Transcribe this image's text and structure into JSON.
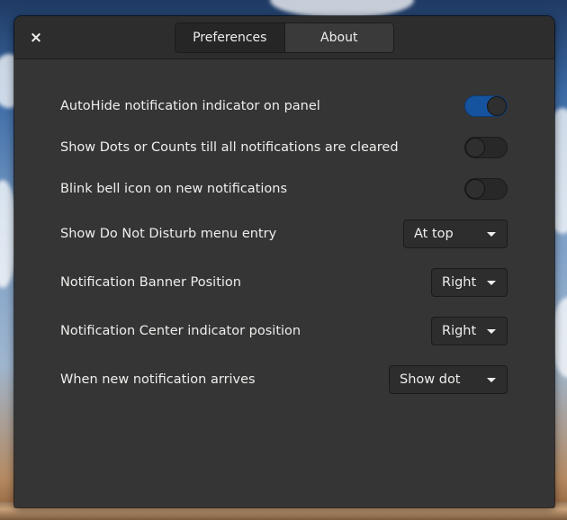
{
  "window": {
    "close_label": "×"
  },
  "tabs": [
    {
      "label": "Preferences",
      "active": true
    },
    {
      "label": "About",
      "active": false
    }
  ],
  "settings": [
    {
      "label": "AutoHide notification indicator on panel",
      "type": "switch",
      "on": true
    },
    {
      "label": "Show Dots or Counts till all notifications are cleared",
      "type": "switch",
      "on": false
    },
    {
      "label": "Blink bell icon on new notifications",
      "type": "switch",
      "on": false
    },
    {
      "label": "Show Do Not Disturb menu entry",
      "type": "dropdown",
      "value": "At top"
    },
    {
      "label": "Notification Banner Position",
      "type": "dropdown",
      "value": "Right"
    },
    {
      "label": "Notification Center indicator position",
      "type": "dropdown",
      "value": "Right"
    },
    {
      "label": "When new notification arrives",
      "type": "dropdown",
      "value": "Show dot"
    }
  ],
  "colors": {
    "accent": "#15539e",
    "window_bg": "#353535",
    "headerbar_bg": "#2d2d2d",
    "text": "#eeeeec"
  }
}
